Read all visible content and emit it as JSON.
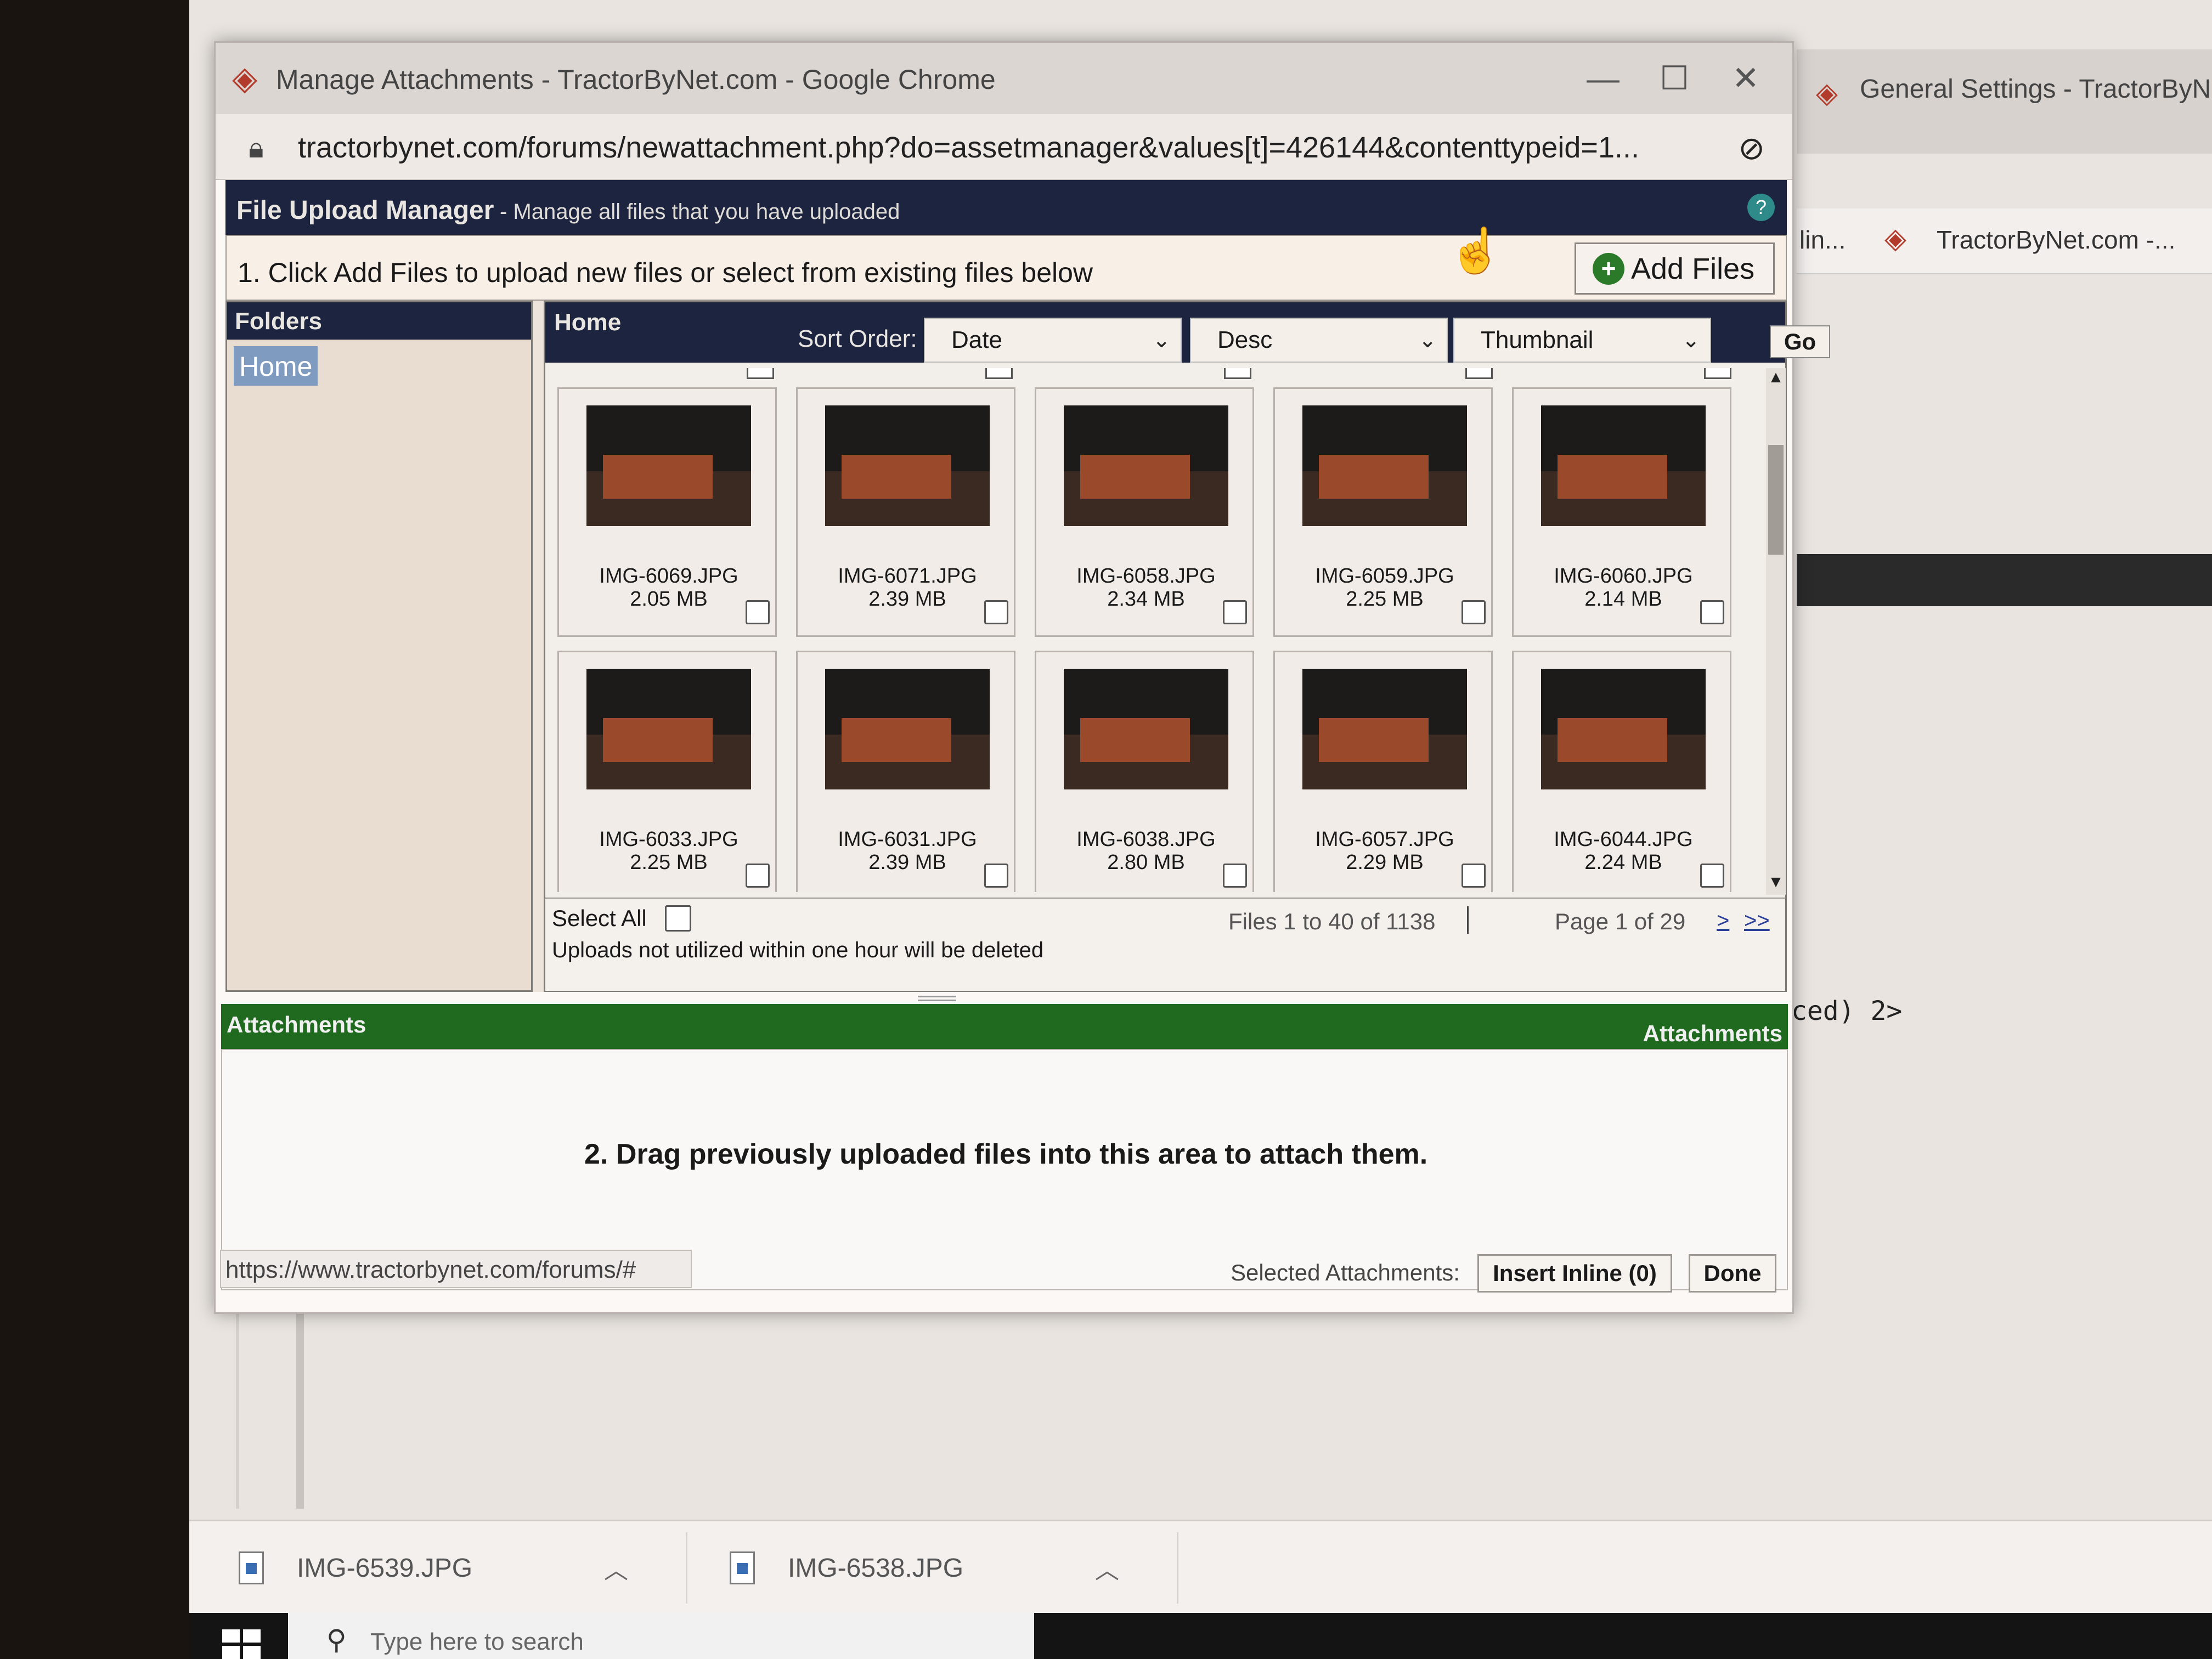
{
  "window": {
    "title": "Manage Attachments - TractorByNet.com - Google Chrome",
    "url": "tractorbynet.com/forums/newattachment.php?do=assetmanager&values[t]=426144&contenttypeid=1...",
    "controls": {
      "minimize": "—",
      "maximize": "☐",
      "close": "✕"
    }
  },
  "background": {
    "other_tab_title": "General Settings - TractorByN",
    "bookmark_1": "lin...",
    "bookmark_2": "TractorByNet.com -...",
    "code_text": "ced) 2>",
    "downloads": [
      {
        "name": "IMG-6539.JPG"
      },
      {
        "name": "IMG-6538.JPG"
      }
    ],
    "taskbar_search_placeholder": "Type here to search"
  },
  "manager": {
    "title": "File Upload Manager",
    "subtitle": "- Manage all files that you have uploaded",
    "help_icon": "?",
    "step1_text": "1. Click Add Files to upload new files or select from existing files below",
    "add_files_label": "Add Files",
    "add_files_icon": "+",
    "folders_header": "Folders",
    "folder_home": "Home",
    "files_header": "Home",
    "sort_label": "Sort Order:",
    "sort_field": "Date",
    "sort_direction": "Desc",
    "view_mode": "Thumbnail",
    "go_label": "Go",
    "files": [
      {
        "name": "IMG-6069.JPG",
        "size": "2.05 MB"
      },
      {
        "name": "IMG-6071.JPG",
        "size": "2.39 MB"
      },
      {
        "name": "IMG-6058.JPG",
        "size": "2.34 MB"
      },
      {
        "name": "IMG-6059.JPG",
        "size": "2.25 MB"
      },
      {
        "name": "IMG-6060.JPG",
        "size": "2.14 MB"
      },
      {
        "name": "IMG-6033.JPG",
        "size": "2.25 MB"
      },
      {
        "name": "IMG-6031.JPG",
        "size": "2.39 MB"
      },
      {
        "name": "IMG-6038.JPG",
        "size": "2.80 MB"
      },
      {
        "name": "IMG-6057.JPG",
        "size": "2.29 MB"
      },
      {
        "name": "IMG-6044.JPG",
        "size": "2.24 MB"
      }
    ],
    "select_all_label": "Select All",
    "uploads_note": "Uploads not utilized within one hour will be deleted",
    "files_range": "Files 1 to 40 of 1138",
    "page_label": "Page 1 of 29",
    "page_next": ">",
    "page_last": ">>"
  },
  "attachments": {
    "header_left": "Attachments",
    "header_right": "Attachments",
    "drop_hint": "2. Drag previously uploaded files into this area to attach them."
  },
  "status": {
    "url": "https://www.tractorbynet.com/forums/#",
    "selected_label": "Selected Attachments:",
    "insert_inline_label": "Insert Inline (0)",
    "done_label": "Done"
  },
  "colors": {
    "header_navy": "#1d2440",
    "attachments_green": "#1f6a1f",
    "folder_selected": "#7f9cc0",
    "link_blue": "#2a3f9a"
  }
}
